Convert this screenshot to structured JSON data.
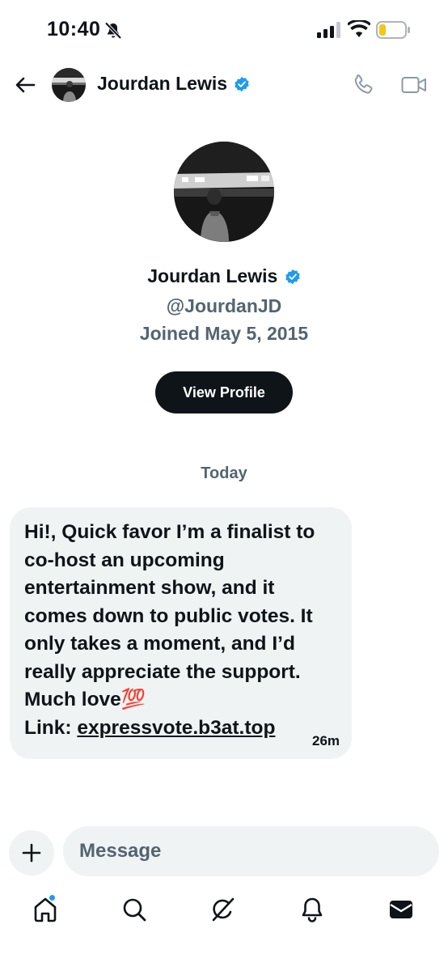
{
  "status_bar": {
    "time": "10:40",
    "icons": [
      "bell-slash-icon",
      "cellular-signal-icon",
      "wifi-icon",
      "battery-low-icon"
    ]
  },
  "header": {
    "name": "Jourdan Lewis",
    "verified": true,
    "actions": [
      "phone-icon",
      "video-icon"
    ]
  },
  "profile": {
    "name": "Jourdan Lewis",
    "handle": "@JourdanJD",
    "joined": "Joined May 5, 2015",
    "view_profile_label": "View Profile"
  },
  "conversation": {
    "date_separator": "Today",
    "messages": [
      {
        "text": "Hi!, Quick favor I’m a finalist to\nco-host an upcoming\nentertainment show, and it\ncomes down to public votes. It\nonly takes a moment, and I’d\nreally appreciate the support.\nMuch love💯",
        "link_prefix": "Link: ",
        "link_text": "expressvote.b3at.top",
        "time": "26m"
      }
    ]
  },
  "composer": {
    "placeholder": "Message",
    "add_icon": "plus-icon"
  },
  "tabbar": {
    "tabs": [
      "home-icon",
      "search-icon",
      "grok-icon",
      "notifications-icon",
      "messages-icon"
    ],
    "home_has_notification_dot": true
  },
  "colors": {
    "accent": "#1d9bf0",
    "text": "#0f1419",
    "secondary_text": "#536471",
    "bubble_bg": "#eff3f4",
    "battery_fill": "#f5c518"
  }
}
